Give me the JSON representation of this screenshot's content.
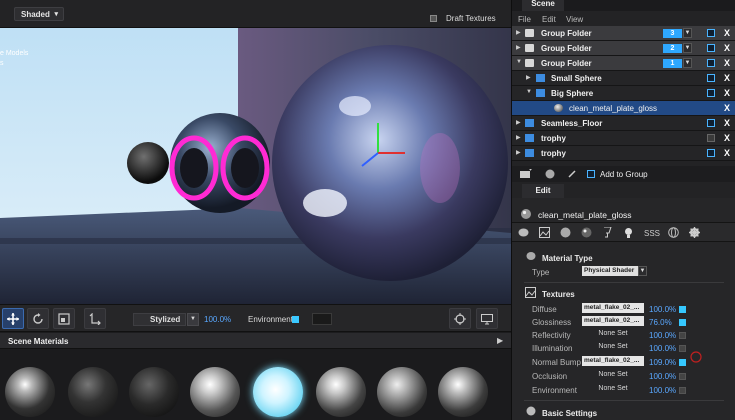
{
  "viewport": {
    "shading_mode": "Shaded",
    "draft_textures_label": "Draft Textures",
    "side_label_line1": "e Models",
    "side_label_line2": "s"
  },
  "viewport_toolbar": {
    "style_mode": "Stylized",
    "style_percent": "100.0%",
    "environment_label": "Environment"
  },
  "scene_materials": {
    "title": "Scene Materials"
  },
  "scene_panel": {
    "tab": "Scene",
    "menu": [
      "File",
      "Edit",
      "View"
    ],
    "tree": [
      {
        "name": "Group Folder",
        "type": "group",
        "number": "3",
        "expanded": false
      },
      {
        "name": "Group Folder",
        "type": "group",
        "number": "2",
        "expanded": false
      },
      {
        "name": "Group Folder",
        "type": "group",
        "number": "1",
        "expanded": true
      },
      {
        "name": "Small Sphere",
        "type": "object",
        "expanded": false
      },
      {
        "name": "Big Sphere",
        "type": "object",
        "expanded": true
      },
      {
        "name": "clean_metal_plate_gloss",
        "type": "material",
        "selected": true
      },
      {
        "name": "Seamless_Floor",
        "type": "object",
        "expanded": false
      },
      {
        "name": "trophy",
        "type": "object",
        "expanded": false
      },
      {
        "name": "trophy",
        "type": "object",
        "expanded": false
      }
    ],
    "add_to_group": "Add to Group"
  },
  "edit_panel": {
    "tab": "Edit",
    "material_name": "clean_metal_plate_gloss",
    "material_type_section": "Material Type",
    "type_label": "Type",
    "type_value": "Physical Shader",
    "textures_section": "Textures",
    "textures": [
      {
        "label": "Diffuse",
        "map": "metal_flake_02_...",
        "percent": "100.0%",
        "enabled": true
      },
      {
        "label": "Glossiness",
        "map": "metal_flake_02_...",
        "percent": "76.0%",
        "enabled": true
      },
      {
        "label": "Reflectivity",
        "map": "None Set",
        "percent": "100.0%",
        "enabled": false
      },
      {
        "label": "Illumination",
        "map": "None Set",
        "percent": "100.0%",
        "enabled": false
      },
      {
        "label": "Normal Bump",
        "map": "metal_flake_02_...",
        "percent": "109.0%",
        "enabled": true
      },
      {
        "label": "Occlusion",
        "map": "None Set",
        "percent": "100.0%",
        "enabled": false
      },
      {
        "label": "Environment",
        "map": "None Set",
        "percent": "100.0%",
        "enabled": false
      }
    ],
    "basic_settings_section": "Basic Settings"
  },
  "colors": {
    "accent": "#2ea8ff",
    "selection": "#224a86",
    "active_toggle": "#36c8ff"
  }
}
